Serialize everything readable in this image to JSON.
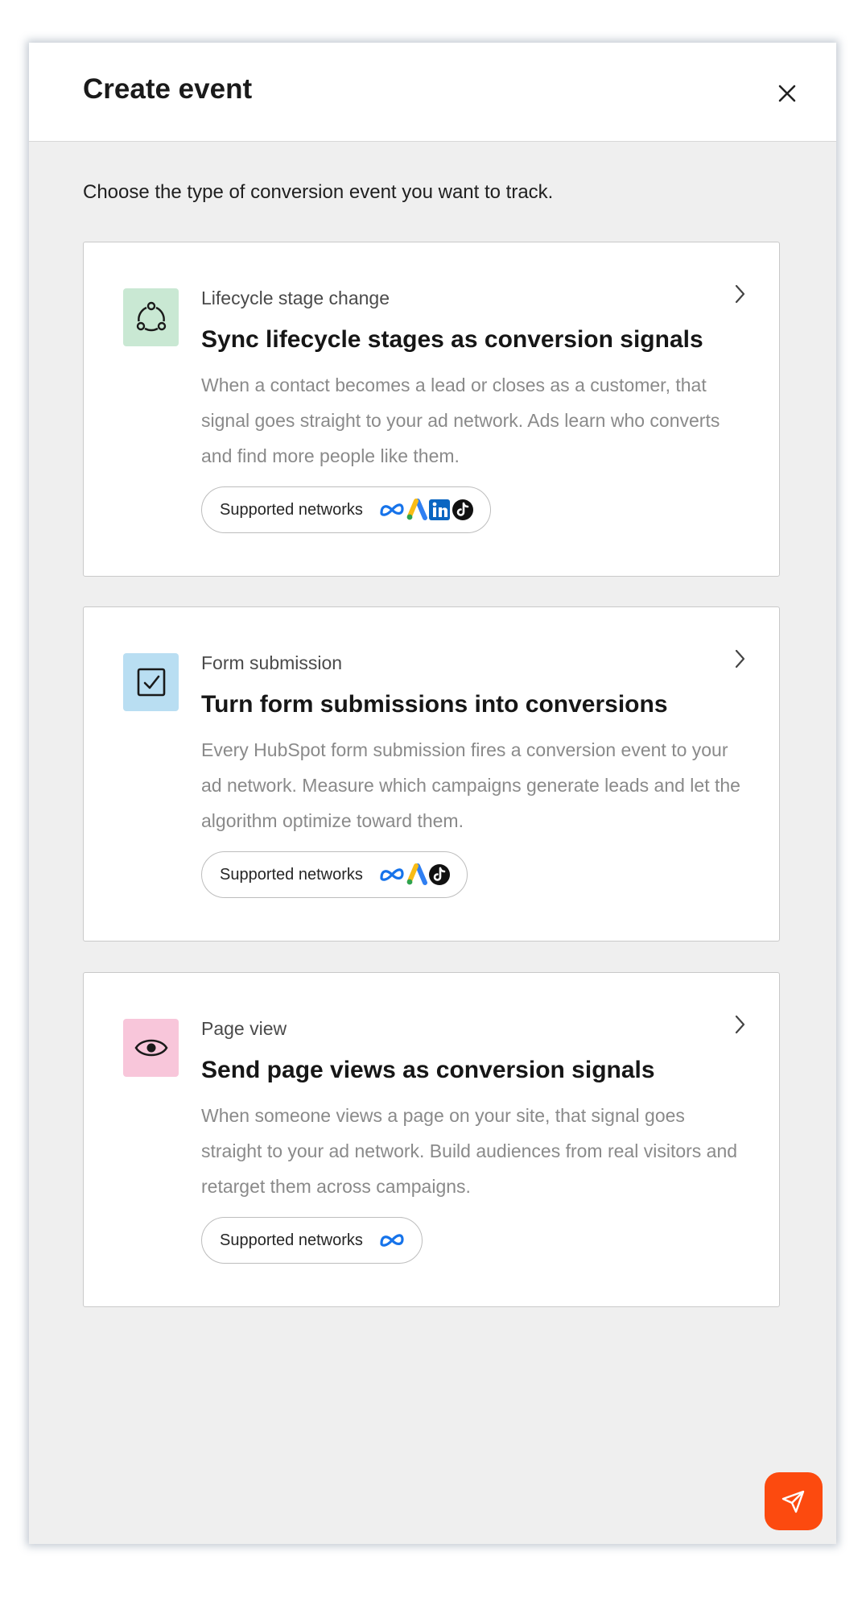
{
  "header": {
    "title": "Create event"
  },
  "intro": "Choose the type of conversion event you want to track.",
  "cards": [
    {
      "kicker": "Lifecycle stage change",
      "heading": "Sync lifecycle stages as conversion signals",
      "description": "When a contact becomes a lead or closes as a customer, that signal goes straight to your ad network. Ads learn who converts and find more people like them.",
      "networks_label": "Supported networks",
      "icon": "lifecycle-cycle-icon",
      "icon_bg": "#c9e8d3",
      "networks": [
        "meta-icon",
        "google-ads-icon",
        "linkedin-icon",
        "tiktok-icon"
      ]
    },
    {
      "kicker": "Form submission",
      "heading": "Turn form submissions into conversions",
      "description": "Every HubSpot form submission fires a conversion event to your ad network. Measure which campaigns generate leads and let the algorithm optimize toward them.",
      "networks_label": "Supported networks",
      "icon": "checkbox-icon",
      "icon_bg": "#b9def2",
      "networks": [
        "meta-icon",
        "google-ads-icon",
        "tiktok-icon"
      ]
    },
    {
      "kicker": "Page view",
      "heading": "Send page views as conversion signals",
      "description": "When someone views a page on your site, that signal goes straight to your ad network. Build audiences from real visitors and retarget them across campaigns.",
      "networks_label": "Supported networks",
      "icon": "eye-icon",
      "icon_bg": "#f8c6da",
      "networks": [
        "meta-icon"
      ]
    }
  ],
  "colors": {
    "accent": "#fc4a0f",
    "meta": "#1673ea",
    "linkedin": "#0a66c2",
    "google_blue": "#2f7ff2",
    "google_yellow": "#f9bc15"
  },
  "fab": {
    "icon": "send-icon"
  }
}
